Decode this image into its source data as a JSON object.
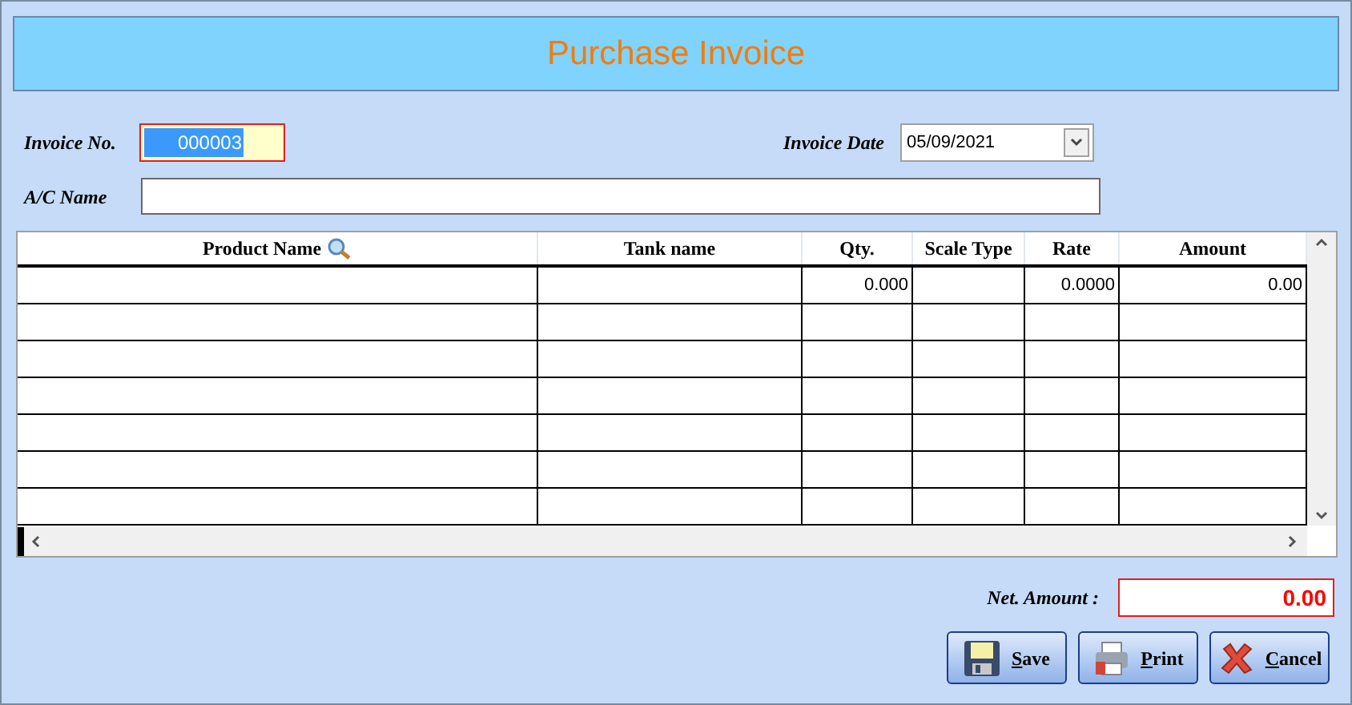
{
  "title": "Purchase Invoice",
  "invoice_no": {
    "label": "Invoice No.",
    "value": "000003"
  },
  "invoice_date": {
    "label": "Invoice Date",
    "value": "05/09/2021"
  },
  "ac_name": {
    "label": "A/C Name"
  },
  "table": {
    "columns": [
      {
        "label": "Product Name",
        "search_icon": true
      },
      {
        "label": "Tank name",
        "search_icon": false
      },
      {
        "label": "Qty.",
        "search_icon": false
      },
      {
        "label": "Scale Type",
        "search_icon": false
      },
      {
        "label": "Rate",
        "search_icon": false
      },
      {
        "label": "Amount",
        "search_icon": false
      }
    ],
    "rows": [
      {
        "qty": "0.000",
        "rate": "0.0000",
        "amount": "0.00"
      },
      {},
      {},
      {},
      {},
      {},
      {}
    ]
  },
  "net_amount": {
    "label": "Net. Amount :",
    "value": "0.00"
  },
  "buttons": [
    {
      "kind": "save",
      "label": "Save"
    },
    {
      "kind": "print",
      "label": "Print"
    },
    {
      "kind": "cancel",
      "label": "Cancel"
    }
  ]
}
